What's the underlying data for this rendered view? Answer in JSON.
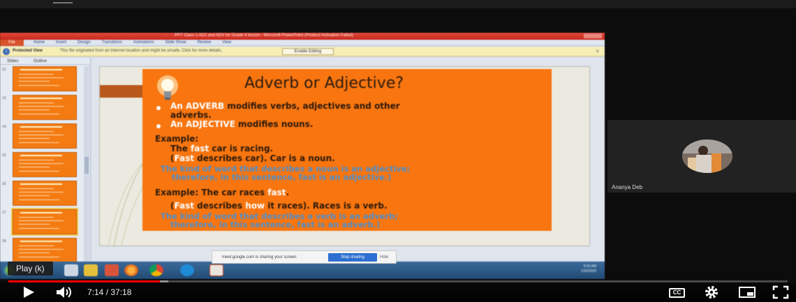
{
  "window": {
    "title": "PPT Class 1 ADJ and ADV for Grade 4 lesson - Microsoft PowerPoint (Product Activation Failed)"
  },
  "ribbon": {
    "file_label": "File",
    "tabs": [
      "Home",
      "Insert",
      "Design",
      "Transitions",
      "Animations",
      "Slide Show",
      "Review",
      "View"
    ]
  },
  "protected_view": {
    "title": "Protected View",
    "message": "This file originated from an Internet location and might be unsafe. Click for more details.",
    "button_label": "Enable Editing",
    "close": "×"
  },
  "slide_panel": {
    "tabs": [
      "Slides",
      "Outline"
    ],
    "thumbnails": [
      "12",
      "13",
      "14",
      "15",
      "16",
      "17",
      "18"
    ],
    "selected_index": 5
  },
  "slide": {
    "title": "Adverb or Adjective?",
    "bullet1_keyword": "An ADVERB",
    "bullet1_rest": " modifies verbs, adjectives and other",
    "bullet1_line2": "adverbs.",
    "bullet2_keyword": "An ADJECTIVE",
    "bullet2_rest": " modifies nouns.",
    "example1_heading": "Example:",
    "ex1_line1_a": "The ",
    "ex1_line1_hl": "fast",
    "ex1_line1_b": " car is racing.",
    "ex1_line2_a": "(",
    "ex1_line2_hl": "Fast",
    "ex1_line2_b": " describes car).   Car is a noun.",
    "ex1_note_line1": "The kind of word that describes a noun is an adjective;",
    "ex1_note_line2": "therefore, in this sentence, fast is an adjective.)",
    "example2_a": "Example: The car races ",
    "example2_hl": "fast",
    "example2_b": ".",
    "ex2_line2_a": "(",
    "ex2_line2_hl1": "Fast",
    "ex2_line2_b": " describes ",
    "ex2_line2_hl2": "how",
    "ex2_line2_c": " it races).   Races is a verb.",
    "ex2_note_line1": "The kind of word that describes a verb is an adverb;",
    "ex2_note_line2": "therefore, in this sentence, fast is an adverb.)"
  },
  "share_notice": {
    "text": "meet.google.com is sharing your screen.",
    "stop_label": "Stop sharing",
    "hide_label": "Hide"
  },
  "taskbar": {
    "clock_time": "9:42 AM",
    "clock_date": "1/30/2020"
  },
  "participant": {
    "name": "Ananya Deb"
  },
  "player": {
    "tooltip": "Play (k)",
    "current_time": "7:14",
    "separator": " / ",
    "duration": "37:18",
    "progress_fraction": 0.194,
    "loaded_fraction": 0.205,
    "cc_label": "CC",
    "accent_color": "#ff0000"
  }
}
